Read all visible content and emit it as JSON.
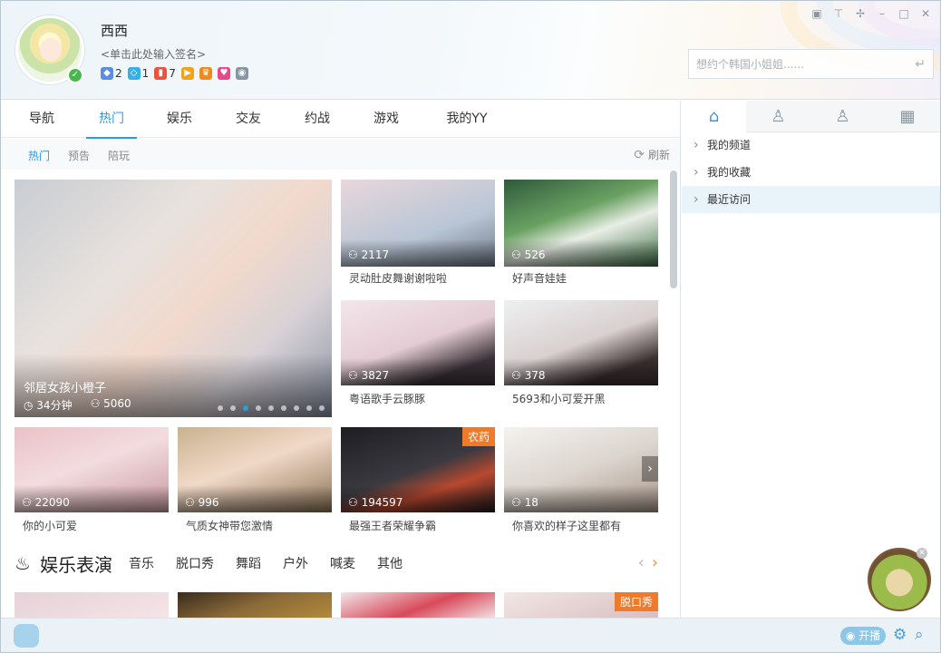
{
  "header": {
    "username": "西西",
    "signature": "<单击此处输入签名>",
    "badges": [
      {
        "icon": "gamepad-icon",
        "color": "#5b8de6",
        "count": "2"
      },
      {
        "icon": "diamond-icon",
        "color": "#35b0e8",
        "count": "1"
      },
      {
        "icon": "level-icon",
        "color": "#e8553c",
        "count": "7"
      },
      {
        "icon": "video-icon",
        "color": "#f3a21c",
        "count": ""
      },
      {
        "icon": "crown-icon",
        "color": "#f08a1a",
        "count": ""
      },
      {
        "icon": "heart-icon",
        "color": "#e4498a",
        "count": ""
      },
      {
        "icon": "eye-icon",
        "color": "#8796a2",
        "count": ""
      }
    ],
    "search_placeholder": "想约个韩国小姐姐......",
    "window_controls": [
      "skin-icon",
      "shirt-icon",
      "pin-icon",
      "minimize-icon",
      "maximize-icon",
      "close-icon"
    ]
  },
  "nav": {
    "tabs": [
      "导航",
      "热门",
      "娱乐",
      "交友",
      "约战",
      "游戏",
      "我的YY"
    ],
    "active": "热门"
  },
  "subnav": {
    "tabs": [
      "热门",
      "预告",
      "陪玩"
    ],
    "refresh": "刷新"
  },
  "featured": {
    "title": "邻居女孩小橙子",
    "duration": "34分钟",
    "viewers": "5060"
  },
  "tiles": [
    {
      "viewers": "2117",
      "caption": "灵动肚皮舞谢谢啦啦",
      "tag": ""
    },
    {
      "viewers": "526",
      "caption": "好声音娃娃",
      "tag": ""
    },
    {
      "viewers": "3827",
      "caption": "粤语歌手云豚豚",
      "tag": ""
    },
    {
      "viewers": "378",
      "caption": "5693和小可爱开黑",
      "tag": ""
    },
    {
      "viewers": "22090",
      "caption": "你的小可爱",
      "tag": ""
    },
    {
      "viewers": "996",
      "caption": "气质女神带您激情",
      "tag": ""
    },
    {
      "viewers": "194597",
      "caption": "最强王者荣耀争霸",
      "tag": "农药"
    },
    {
      "viewers": "18",
      "caption": "你喜欢的样子这里都有",
      "tag": ""
    }
  ],
  "section": {
    "title": "娱乐表演",
    "links": [
      "音乐",
      "脱口秀",
      "舞蹈",
      "户外",
      "喊麦",
      "其他"
    ],
    "bottom_tag": "脱口秀"
  },
  "sidebar": {
    "tabs": [
      "home-icon",
      "person-icon",
      "friends-icon",
      "apps-icon"
    ],
    "items": [
      "我的频道",
      "我的收藏",
      "最近访问"
    ]
  },
  "statusbar": {
    "live_label": "开播"
  }
}
